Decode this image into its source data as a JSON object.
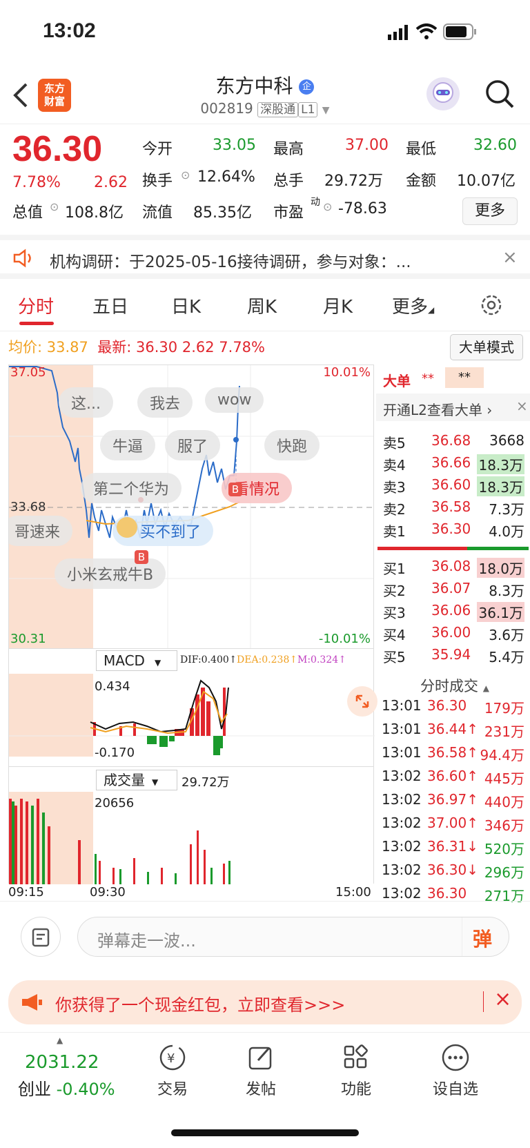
{
  "status": {
    "time": "13:02"
  },
  "stock": {
    "name": "东方中科",
    "code": "002819",
    "tag1": "深股通",
    "tag2": "L1",
    "price": "36.30",
    "pct": "7.78%",
    "change": "2.62",
    "open_label": "今开",
    "open": "33.05",
    "high_label": "最高",
    "high": "37.00",
    "low_label": "最低",
    "low": "32.60",
    "turnover_label": "换手",
    "turnover": "12.64%",
    "volume_label": "总手",
    "volume": "29.72万",
    "amount_label": "金额",
    "amount": "10.07亿",
    "mktcap_label": "总值",
    "mktcap": "108.8亿",
    "float_label": "流值",
    "float": "85.35亿",
    "pe_label": "市盈",
    "pe_sup": "动",
    "pe": "-78.63",
    "more": "更多"
  },
  "notice": {
    "text": "机构调研：于2025-05-16接待调研，参与对象：..."
  },
  "tabs": [
    "分时",
    "五日",
    "日K",
    "周K",
    "月K",
    "更多"
  ],
  "info": {
    "avg_label": "均价:",
    "avg": "33.87",
    "last_label": "最新:",
    "last": "36.30",
    "chg": "2.62",
    "pct": "7.78%",
    "bigmode": "大单模式"
  },
  "axis": {
    "top": "37.05",
    "mid": "33.68",
    "bottom": "30.31",
    "pct_top": "10.01%",
    "pct_bottom": "-10.01%",
    "t_start": "09:15",
    "t_mid": "09:30",
    "t_end": "15:00"
  },
  "danmu": [
    "这...",
    "我去",
    "wow",
    "牛逼",
    "服了",
    "快跑",
    "第二个华为",
    "看情况",
    "哥速来",
    "买不到了",
    "小米玄戒牛B"
  ],
  "marker": "B",
  "macd": {
    "label": "MACD",
    "dif": "DIF:0.400↑",
    "dea": "DEA:0.238↑",
    "m": "M:0.324↑",
    "hi": "0.434",
    "lo": "-0.170"
  },
  "vol": {
    "label": "成交量",
    "value": "29.72万",
    "hi": "20656"
  },
  "orderbook": {
    "title": "大单",
    "stars1": "**",
    "stars2": "**",
    "l2": "开通L2查看大单 ›",
    "asks": [
      {
        "label": "卖5",
        "price": "36.68",
        "vol": "3668"
      },
      {
        "label": "卖4",
        "price": "36.66",
        "vol": "18.3万"
      },
      {
        "label": "卖3",
        "price": "36.60",
        "vol": "18.3万"
      },
      {
        "label": "卖2",
        "price": "36.58",
        "vol": "7.3万"
      },
      {
        "label": "卖1",
        "price": "36.30",
        "vol": "4.0万"
      }
    ],
    "bids": [
      {
        "label": "买1",
        "price": "36.08",
        "vol": "18.0万"
      },
      {
        "label": "买2",
        "price": "36.07",
        "vol": "8.3万"
      },
      {
        "label": "买3",
        "price": "36.06",
        "vol": "36.1万"
      },
      {
        "label": "买4",
        "price": "36.00",
        "vol": "3.6万"
      },
      {
        "label": "买5",
        "price": "35.94",
        "vol": "5.4万"
      }
    ]
  },
  "trades": {
    "title": "分时成交",
    "rows": [
      {
        "t": "13:01",
        "p": "36.30",
        "v": "179万",
        "dir": ""
      },
      {
        "t": "13:01",
        "p": "36.44↑",
        "v": "231万",
        "dir": "up"
      },
      {
        "t": "13:01",
        "p": "36.58↑",
        "v": "94.4万",
        "dir": "up"
      },
      {
        "t": "13:02",
        "p": "36.60↑",
        "v": "445万",
        "dir": "up"
      },
      {
        "t": "13:02",
        "p": "36.97↑",
        "v": "440万",
        "dir": "up"
      },
      {
        "t": "13:02",
        "p": "37.00↑",
        "v": "346万",
        "dir": "up"
      },
      {
        "t": "13:02",
        "p": "36.31↓",
        "v": "520万",
        "dir": "down"
      },
      {
        "t": "13:02",
        "p": "36.30↓",
        "v": "296万",
        "dir": "down"
      },
      {
        "t": "13:02",
        "p": "36.30",
        "v": "271万",
        "dir": ""
      }
    ]
  },
  "comment": {
    "placeholder": "弹幕走一波...",
    "send": "弹"
  },
  "banner": {
    "text": "你获得了一个现金红包，立即查看>>>"
  },
  "dock": {
    "index_value": "2031.22",
    "index_name": "创业",
    "index_pct": "-0.40%",
    "trade": "交易",
    "post": "发帖",
    "func": "功能",
    "watch": "设自选"
  },
  "colors": {
    "up": "#e0262d",
    "down": "#1a9a2c",
    "avg": "#f0a020",
    "brand": "#f25d22"
  }
}
